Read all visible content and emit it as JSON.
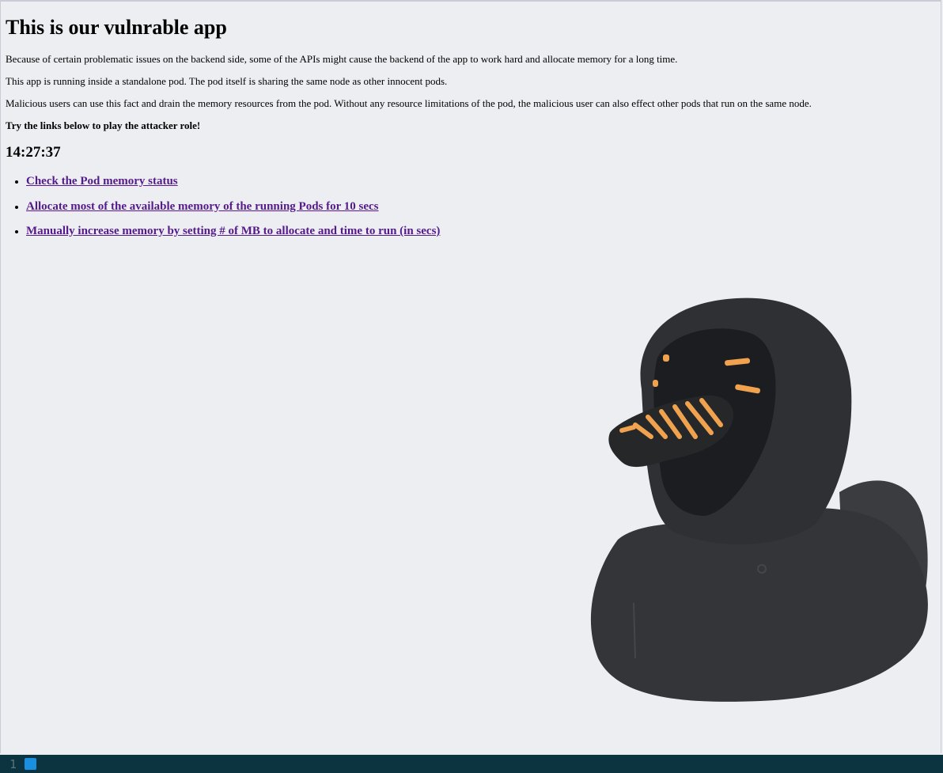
{
  "page": {
    "title": "This is our vulnrable app",
    "paragraphs": [
      "Because of certain problematic issues on the backend side, some of the APIs might cause the backend of the app to work hard and allocate memory for a long time.",
      "This app is running inside a standalone pod. The pod itself is sharing the same node as other innocent pods.",
      "Malicious users can use this fact and drain the memory resources from the pod. Without any resource limitations of the pod, the malicious user can also effect other pods that run on the same node.",
      "Try the links below to play the attacker role!"
    ],
    "clock": "14:27:37",
    "links": [
      "Check the Pod memory status",
      "Allocate most of the available memory of the running Pods for 10 secs",
      "Manually increase memory by setting # of MB to allocate and time to run (in secs)"
    ],
    "image": "black-hooded-rubber-duck"
  },
  "statusbar": {
    "line_number": "1"
  },
  "colors": {
    "link": "#551a8b",
    "statusbar_bg": "#0b3440",
    "indicator": "#1a8fe0",
    "background": "#eceef1"
  }
}
